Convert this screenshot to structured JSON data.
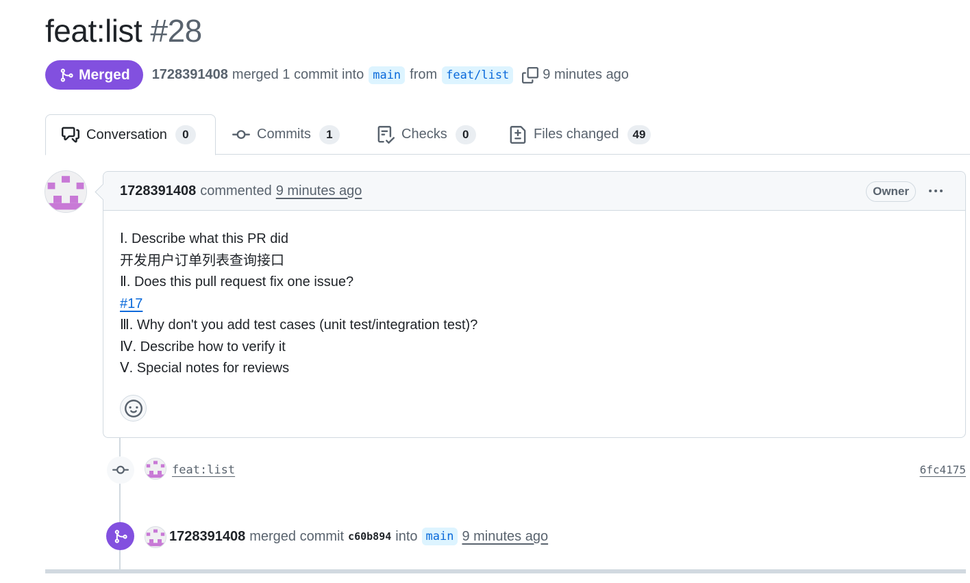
{
  "pr": {
    "title": "feat:list",
    "number": "#28",
    "state": "Merged",
    "author": "1728391408",
    "summary_text": "merged 1 commit into",
    "base_branch": "main",
    "from_text": "from",
    "head_branch": "feat/list",
    "time_ago": "9 minutes ago"
  },
  "tabs": [
    {
      "label": "Conversation",
      "count": "0",
      "icon": "comment-discussion-icon"
    },
    {
      "label": "Commits",
      "count": "1",
      "icon": "git-commit-icon"
    },
    {
      "label": "Checks",
      "count": "0",
      "icon": "checklist-icon"
    },
    {
      "label": "Files changed",
      "count": "49",
      "icon": "file-diff-icon"
    }
  ],
  "comment": {
    "author": "1728391408",
    "action": "commented",
    "time": "9 minutes ago",
    "badge": "Owner",
    "lines": [
      "Ⅰ. Describe what this PR did",
      "开发用户订单列表查询接口",
      "Ⅱ. Does this pull request fix one issue?",
      "#17",
      "Ⅲ. Why don't you add test cases (unit test/integration test)?",
      "Ⅳ. Describe how to verify it",
      "Ⅴ. Special notes for reviews"
    ]
  },
  "timeline": {
    "commit": {
      "message": "feat:list",
      "sha": "6fc4175"
    },
    "merge": {
      "author": "1728391408",
      "text": "merged commit",
      "sha": "c60b894",
      "into": "into",
      "branch": "main",
      "time": "9 minutes ago"
    }
  },
  "colors": {
    "merged": "#8250df",
    "link": "#0969da",
    "branch_bg": "#ddf4ff",
    "avatar": "#c879d6"
  }
}
